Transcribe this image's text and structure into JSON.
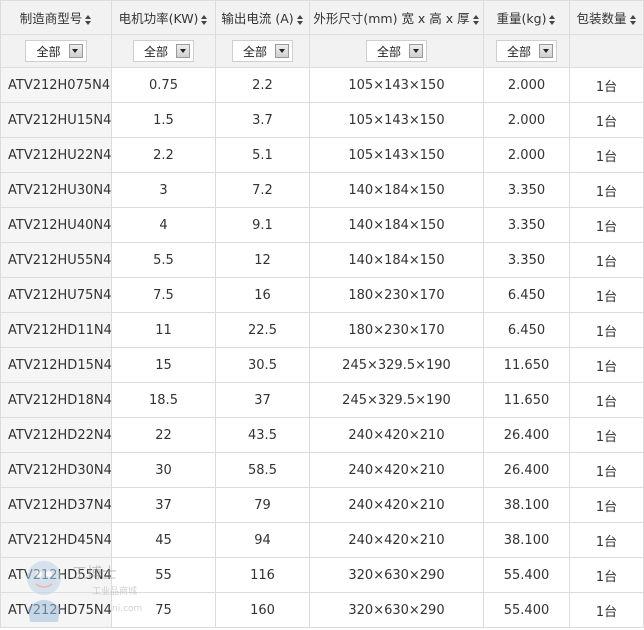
{
  "columns": [
    {
      "label": "制造商型号",
      "filter": null
    },
    {
      "label": "电机功率(KW)",
      "filter": "全部"
    },
    {
      "label": "输出电流 (A)",
      "filter": "全部"
    },
    {
      "label": "外形尺寸(mm) 宽 x 高 x 厚",
      "filter": "全部"
    },
    {
      "label": "重量(kg)",
      "filter": "全部"
    },
    {
      "label": "包装数量",
      "filter": null
    }
  ],
  "first_filter": "全部",
  "rows": [
    [
      "ATV212H075N4",
      "0.75",
      "2.2",
      "105×143×150",
      "2.000",
      "1台"
    ],
    [
      "ATV212HU15N4",
      "1.5",
      "3.7",
      "105×143×150",
      "2.000",
      "1台"
    ],
    [
      "ATV212HU22N4",
      "2.2",
      "5.1",
      "105×143×150",
      "2.000",
      "1台"
    ],
    [
      "ATV212HU30N4",
      "3",
      "7.2",
      "140×184×150",
      "3.350",
      "1台"
    ],
    [
      "ATV212HU40N4",
      "4",
      "9.1",
      "140×184×150",
      "3.350",
      "1台"
    ],
    [
      "ATV212HU55N4",
      "5.5",
      "12",
      "140×184×150",
      "3.350",
      "1台"
    ],
    [
      "ATV212HU75N4",
      "7.5",
      "16",
      "180×230×170",
      "6.450",
      "1台"
    ],
    [
      "ATV212HD11N4",
      "11",
      "22.5",
      "180×230×170",
      "6.450",
      "1台"
    ],
    [
      "ATV212HD15N4",
      "15",
      "30.5",
      "245×329.5×190",
      "11.650",
      "1台"
    ],
    [
      "ATV212HD18N4",
      "18.5",
      "37",
      "245×329.5×190",
      "11.650",
      "1台"
    ],
    [
      "ATV212HD22N4",
      "22",
      "43.5",
      "240×420×210",
      "26.400",
      "1台"
    ],
    [
      "ATV212HD30N4",
      "30",
      "58.5",
      "240×420×210",
      "26.400",
      "1台"
    ],
    [
      "ATV212HD37N4",
      "37",
      "79",
      "240×420×210",
      "38.100",
      "1台"
    ],
    [
      "ATV212HD45N4",
      "45",
      "94",
      "240×420×210",
      "38.100",
      "1台"
    ],
    [
      "ATV212HD55N4",
      "55",
      "116",
      "320×630×290",
      "55.400",
      "1台"
    ],
    [
      "ATV212HD75N4",
      "75",
      "160",
      "320×630×290",
      "55.400",
      "1台"
    ]
  ],
  "watermark": {
    "brand": "工博士",
    "tagline": "工业品商城",
    "url_fragment": "ni.com"
  }
}
